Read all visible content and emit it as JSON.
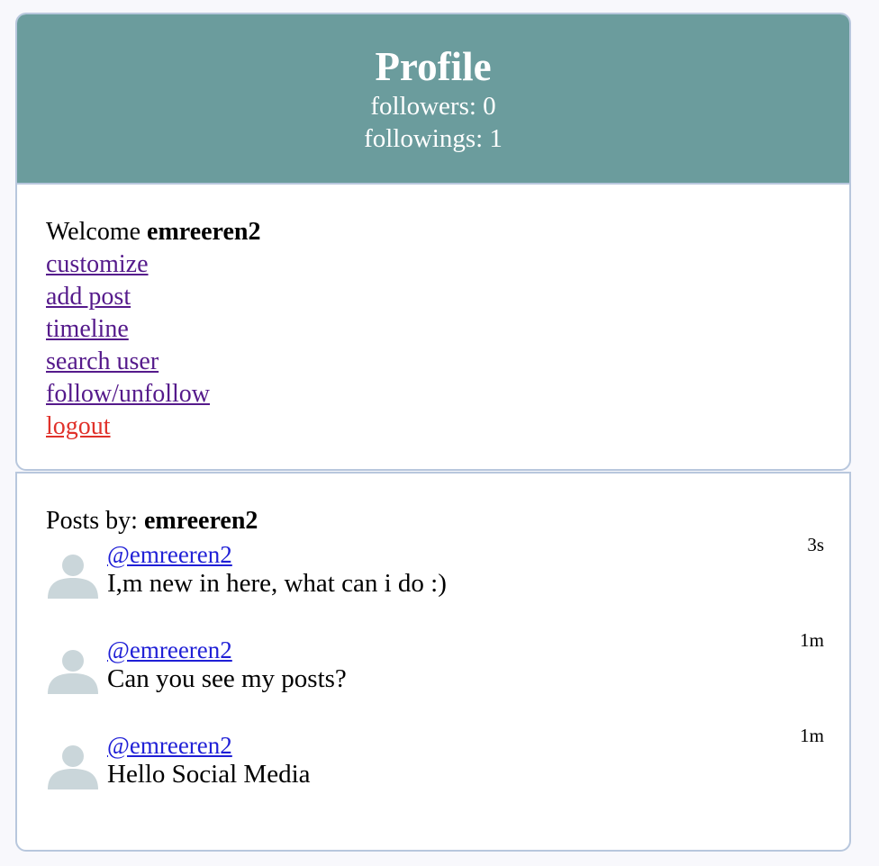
{
  "profile": {
    "title": "Profile",
    "followers_text": "followers: 0",
    "followings_text": "followings: 1",
    "welcome_prefix": "Welcome ",
    "username": "emreeren2",
    "links": {
      "customize": "customize",
      "add_post": "add post",
      "timeline": "timeline",
      "search_user": "search user",
      "follow_unfollow": "follow/unfollow",
      "logout": "logout"
    }
  },
  "posts": {
    "heading_prefix": "Posts by: ",
    "username": "emreeren2",
    "items": [
      {
        "user": "@emreeren2",
        "text": "I,m new in here, what can i do :)",
        "time": "3s"
      },
      {
        "user": "@emreeren2",
        "text": "Can you see my posts?",
        "time": "1m"
      },
      {
        "user": "@emreeren2",
        "text": "Hello Social Media",
        "time": "1m"
      }
    ]
  },
  "colors": {
    "header_bg": "#6b9c9d",
    "visited_link": "#551a8b",
    "logout_link": "#e0312a",
    "user_link": "#1f1fd6",
    "avatar": "#cad6da",
    "border": "#b8c7dd"
  },
  "icons": {
    "avatar": "user-silhouette-icon"
  }
}
